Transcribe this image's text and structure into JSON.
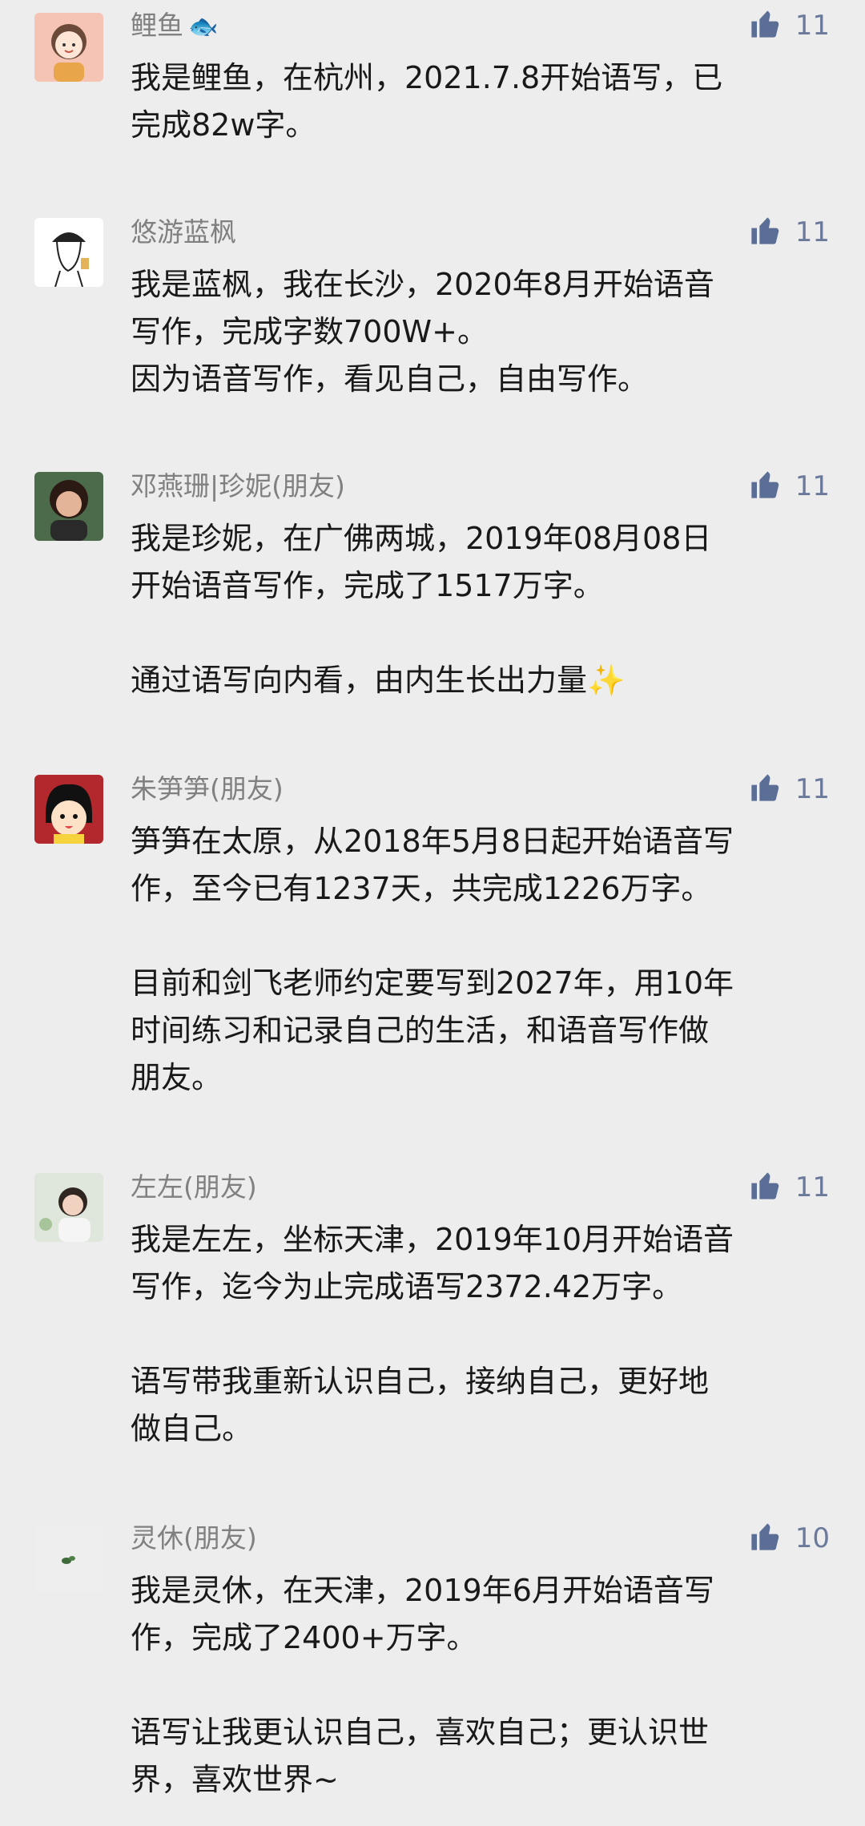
{
  "comments": [
    {
      "name": "鲤鱼",
      "name_emoji": "🐟",
      "likes": "11",
      "lines": [
        "我是鲤鱼，在杭州，2021.7.8开始语写，已",
        "完成82w字。"
      ]
    },
    {
      "name": "悠游蓝枫",
      "likes": "11",
      "lines": [
        "我是蓝枫，我在长沙，2020年8月开始语音",
        "写作，完成字数700W+。",
        "因为语音写作，看见自己，自由写作。"
      ]
    },
    {
      "name": "邓燕珊|珍妮(朋友)",
      "likes": "11",
      "lines": [
        "我是珍妮，在广佛两城，2019年08月08日",
        "开始语音写作，完成了1517万字。",
        "",
        "通过语写向内看，由内生长出力量"
      ],
      "trailing_emoji": "✨"
    },
    {
      "name": "朱笋笋(朋友)",
      "likes": "11",
      "lines": [
        "笋笋在太原，从2018年5月8日起开始语音写",
        "作，至今已有1237天，共完成1226万字。",
        "",
        "目前和剑飞老师约定要写到2027年，用10年",
        "时间练习和记录自己的生活，和语音写作做",
        "朋友。"
      ]
    },
    {
      "name": "左左(朋友)",
      "likes": "11",
      "lines": [
        "我是左左，坐标天津，2019年10月开始语音",
        "写作，迄今为止完成语写2372.42万字。",
        "",
        "语写带我重新认识自己，接纳自己，更好地",
        "做自己。"
      ]
    },
    {
      "name": "灵休(朋友)",
      "likes": "10",
      "lines": [
        "我是灵休，在天津，2019年6月开始语音写",
        "作，完成了2400+万字。",
        "",
        "语写让我更认识自己，喜欢自己；更认识世",
        "界，喜欢世界~"
      ]
    }
  ],
  "colors": {
    "background": "#ededed",
    "name": "#808080",
    "like_icon": "#5b6e96",
    "like_count": "#6b7a9b",
    "text": "#191919"
  },
  "icons": {
    "like": "thumbs-up-icon",
    "sparkle": "sparkles-icon"
  }
}
